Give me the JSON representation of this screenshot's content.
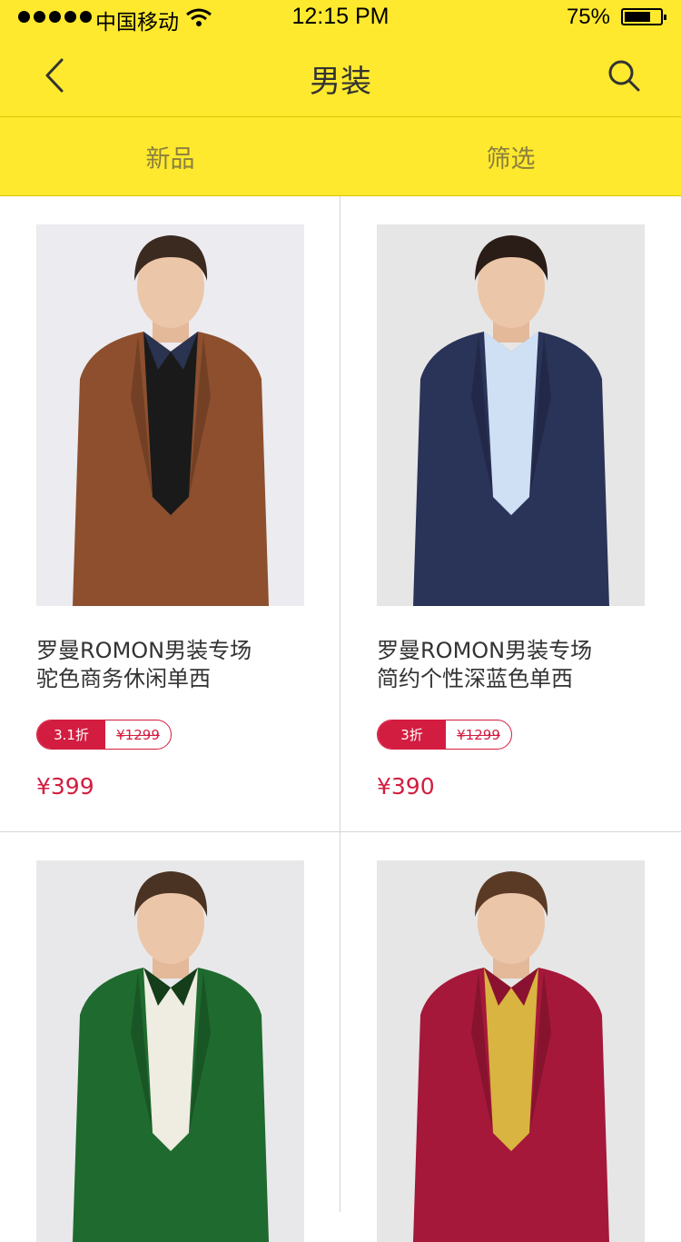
{
  "status_bar": {
    "carrier": "中国移动",
    "time": "12:15 PM",
    "battery": "75%",
    "battery_level": 0.75
  },
  "header": {
    "title": "男装",
    "back_icon": "chevron-left-icon",
    "search_icon": "search-icon"
  },
  "tabs": [
    {
      "label": "新品"
    },
    {
      "label": "筛选"
    }
  ],
  "products": [
    {
      "title_line1": "罗曼ROMON男装专场",
      "title_line2": "驼色商务休闲单西",
      "discount": "3.1折",
      "original_price": "¥1299",
      "price": "¥399",
      "jacket_color": "#8d4f2e",
      "inner_color": "#1a1a1a",
      "collar_color": "#2a3350",
      "hair_color": "#3a2a20",
      "bg_color": "#ebebf0"
    },
    {
      "title_line1": "罗曼ROMON男装专场",
      "title_line2": "简约个性深蓝色单西",
      "discount": "3折",
      "original_price": "¥1299",
      "price": "¥390",
      "jacket_color": "#2a3358",
      "inner_color": "#cfe0f4",
      "collar_color": "#cfe0f4",
      "hair_color": "#2a1c16",
      "bg_color": "#e6e6e6"
    },
    {
      "jacket_color": "#1f6a2e",
      "inner_color": "#efece2",
      "collar_color": "#143d1a",
      "hair_color": "#4a3322",
      "bg_color": "#e8e8ea"
    },
    {
      "jacket_color": "#a5183a",
      "inner_color": "#d9b440",
      "collar_color": "#8a1230",
      "hair_color": "#5b3a25",
      "bg_color": "#e6e6e6"
    }
  ],
  "colors": {
    "brand_yellow": "#ffe92e",
    "accent_red": "#d31d40"
  }
}
